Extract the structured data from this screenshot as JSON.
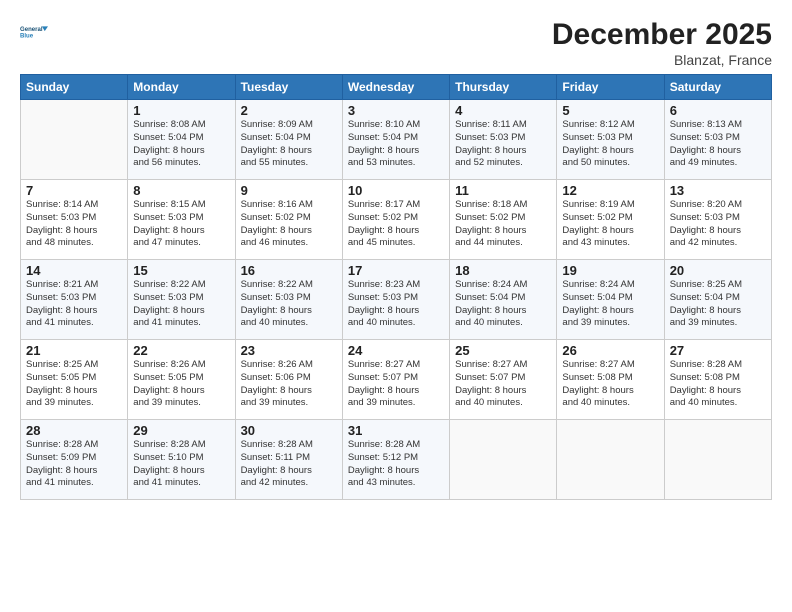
{
  "header": {
    "logo_line1": "General",
    "logo_line2": "Blue",
    "month": "December 2025",
    "location": "Blanzat, France"
  },
  "days_of_week": [
    "Sunday",
    "Monday",
    "Tuesday",
    "Wednesday",
    "Thursday",
    "Friday",
    "Saturday"
  ],
  "weeks": [
    [
      {
        "num": "",
        "info": ""
      },
      {
        "num": "1",
        "info": "Sunrise: 8:08 AM\nSunset: 5:04 PM\nDaylight: 8 hours\nand 56 minutes."
      },
      {
        "num": "2",
        "info": "Sunrise: 8:09 AM\nSunset: 5:04 PM\nDaylight: 8 hours\nand 55 minutes."
      },
      {
        "num": "3",
        "info": "Sunrise: 8:10 AM\nSunset: 5:04 PM\nDaylight: 8 hours\nand 53 minutes."
      },
      {
        "num": "4",
        "info": "Sunrise: 8:11 AM\nSunset: 5:03 PM\nDaylight: 8 hours\nand 52 minutes."
      },
      {
        "num": "5",
        "info": "Sunrise: 8:12 AM\nSunset: 5:03 PM\nDaylight: 8 hours\nand 50 minutes."
      },
      {
        "num": "6",
        "info": "Sunrise: 8:13 AM\nSunset: 5:03 PM\nDaylight: 8 hours\nand 49 minutes."
      }
    ],
    [
      {
        "num": "7",
        "info": "Sunrise: 8:14 AM\nSunset: 5:03 PM\nDaylight: 8 hours\nand 48 minutes."
      },
      {
        "num": "8",
        "info": "Sunrise: 8:15 AM\nSunset: 5:03 PM\nDaylight: 8 hours\nand 47 minutes."
      },
      {
        "num": "9",
        "info": "Sunrise: 8:16 AM\nSunset: 5:02 PM\nDaylight: 8 hours\nand 46 minutes."
      },
      {
        "num": "10",
        "info": "Sunrise: 8:17 AM\nSunset: 5:02 PM\nDaylight: 8 hours\nand 45 minutes."
      },
      {
        "num": "11",
        "info": "Sunrise: 8:18 AM\nSunset: 5:02 PM\nDaylight: 8 hours\nand 44 minutes."
      },
      {
        "num": "12",
        "info": "Sunrise: 8:19 AM\nSunset: 5:02 PM\nDaylight: 8 hours\nand 43 minutes."
      },
      {
        "num": "13",
        "info": "Sunrise: 8:20 AM\nSunset: 5:03 PM\nDaylight: 8 hours\nand 42 minutes."
      }
    ],
    [
      {
        "num": "14",
        "info": "Sunrise: 8:21 AM\nSunset: 5:03 PM\nDaylight: 8 hours\nand 41 minutes."
      },
      {
        "num": "15",
        "info": "Sunrise: 8:22 AM\nSunset: 5:03 PM\nDaylight: 8 hours\nand 41 minutes."
      },
      {
        "num": "16",
        "info": "Sunrise: 8:22 AM\nSunset: 5:03 PM\nDaylight: 8 hours\nand 40 minutes."
      },
      {
        "num": "17",
        "info": "Sunrise: 8:23 AM\nSunset: 5:03 PM\nDaylight: 8 hours\nand 40 minutes."
      },
      {
        "num": "18",
        "info": "Sunrise: 8:24 AM\nSunset: 5:04 PM\nDaylight: 8 hours\nand 40 minutes."
      },
      {
        "num": "19",
        "info": "Sunrise: 8:24 AM\nSunset: 5:04 PM\nDaylight: 8 hours\nand 39 minutes."
      },
      {
        "num": "20",
        "info": "Sunrise: 8:25 AM\nSunset: 5:04 PM\nDaylight: 8 hours\nand 39 minutes."
      }
    ],
    [
      {
        "num": "21",
        "info": "Sunrise: 8:25 AM\nSunset: 5:05 PM\nDaylight: 8 hours\nand 39 minutes."
      },
      {
        "num": "22",
        "info": "Sunrise: 8:26 AM\nSunset: 5:05 PM\nDaylight: 8 hours\nand 39 minutes."
      },
      {
        "num": "23",
        "info": "Sunrise: 8:26 AM\nSunset: 5:06 PM\nDaylight: 8 hours\nand 39 minutes."
      },
      {
        "num": "24",
        "info": "Sunrise: 8:27 AM\nSunset: 5:07 PM\nDaylight: 8 hours\nand 39 minutes."
      },
      {
        "num": "25",
        "info": "Sunrise: 8:27 AM\nSunset: 5:07 PM\nDaylight: 8 hours\nand 40 minutes."
      },
      {
        "num": "26",
        "info": "Sunrise: 8:27 AM\nSunset: 5:08 PM\nDaylight: 8 hours\nand 40 minutes."
      },
      {
        "num": "27",
        "info": "Sunrise: 8:28 AM\nSunset: 5:08 PM\nDaylight: 8 hours\nand 40 minutes."
      }
    ],
    [
      {
        "num": "28",
        "info": "Sunrise: 8:28 AM\nSunset: 5:09 PM\nDaylight: 8 hours\nand 41 minutes."
      },
      {
        "num": "29",
        "info": "Sunrise: 8:28 AM\nSunset: 5:10 PM\nDaylight: 8 hours\nand 41 minutes."
      },
      {
        "num": "30",
        "info": "Sunrise: 8:28 AM\nSunset: 5:11 PM\nDaylight: 8 hours\nand 42 minutes."
      },
      {
        "num": "31",
        "info": "Sunrise: 8:28 AM\nSunset: 5:12 PM\nDaylight: 8 hours\nand 43 minutes."
      },
      {
        "num": "",
        "info": ""
      },
      {
        "num": "",
        "info": ""
      },
      {
        "num": "",
        "info": ""
      }
    ]
  ]
}
